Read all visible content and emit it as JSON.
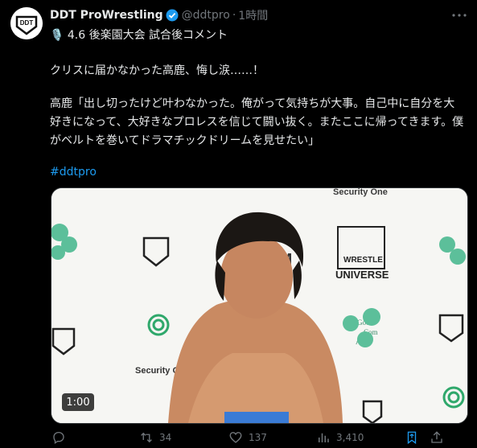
{
  "author": {
    "display_name": "DDT ProWrestling",
    "handle": "@ddtpro",
    "separator": "·",
    "time": "1時間",
    "avatar_logo_text": "DDT"
  },
  "post": {
    "line1": "🎙️ 4.6 後楽園大会 試合後コメント",
    "line2": "クリスに届かなかった高鹿、悔し涙……！",
    "line3": "高鹿「出し切ったけど叶わなかった。俺がって気持ちが大事。自己中に自分を大好きになって、大好きなプロレスを信じて闘い抜く。またここに帰ってきます。僕がベルトを巻いてドラマチックドリームを見せたい」",
    "hashtag": "#ddtpro"
  },
  "media": {
    "duration": "1:00",
    "backdrop_texts": [
      "Security One",
      "SPM",
      "Security One",
      "WRESTLE",
      "UNIVERSE",
      "Good",
      "Com",
      "Asset"
    ]
  },
  "actions": {
    "replies": "",
    "reposts": "34",
    "likes": "137",
    "views": "3,410"
  },
  "colors": {
    "background": "#000000",
    "text": "#e7e9ea",
    "muted": "#71767b",
    "link": "#1d9bf0",
    "verified": "#1d9bf0",
    "bookmark_active": "#1d9bf0"
  }
}
